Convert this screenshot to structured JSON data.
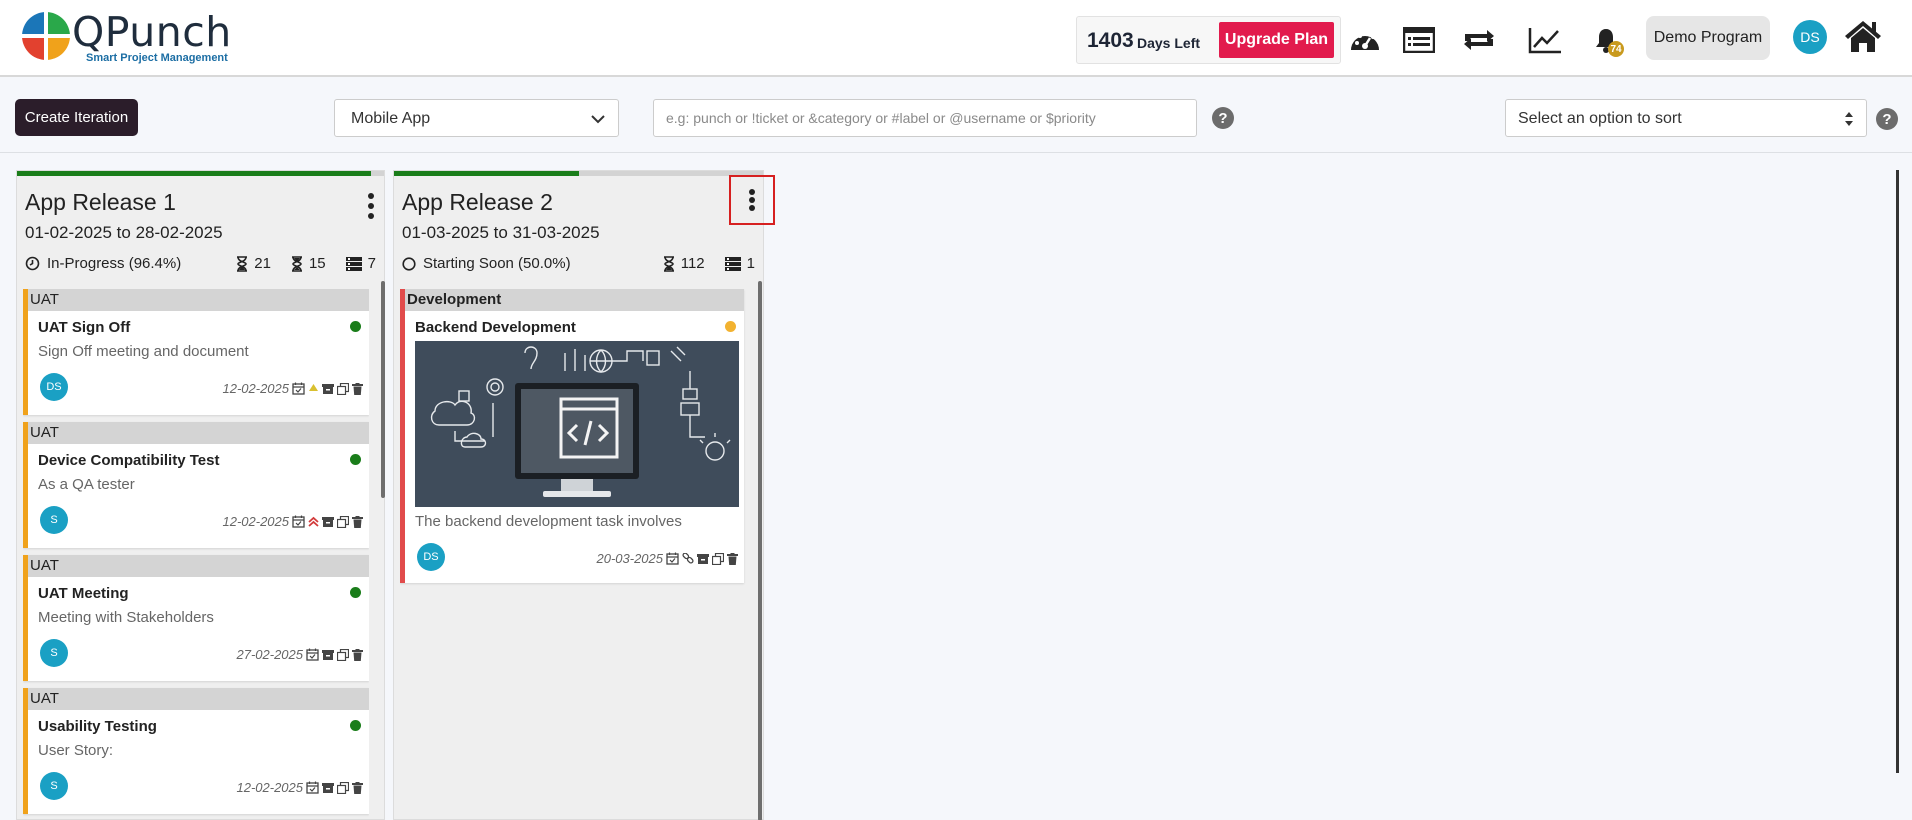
{
  "header": {
    "logo_text": "QPunch",
    "logo_tagline": "Smart Project Management",
    "days_left_number": "1403",
    "days_left_label": "Days Left",
    "upgrade_label": "Upgrade Plan",
    "notification_count": "74",
    "program_label": "Demo Program",
    "user_initials": "DS"
  },
  "toolbar": {
    "create_label": "Create Iteration",
    "project_selected": "Mobile App",
    "search_placeholder": "e.g: punch or !ticket or &category or #label or @username or $priority",
    "sort_placeholder": "Select an option to sort",
    "help_glyph": "?"
  },
  "iterations": [
    {
      "title": "App Release 1",
      "dates": "01-02-2025 to 28-02-2025",
      "status": "In-Progress (96.4%)",
      "progress": 0.964,
      "stat_a": "21",
      "stat_b": "15",
      "stat_c": "7",
      "cards": [
        {
          "category": "UAT",
          "title": "UAT Sign Off",
          "desc": "Sign Off meeting and document",
          "assignee": "DS",
          "date": "12-02-2025",
          "status_color": "#1a7d1a",
          "priority": "up-yellow"
        },
        {
          "category": "UAT",
          "title": "Device Compatibility Test",
          "desc": "As a QA tester",
          "assignee": "S",
          "date": "12-02-2025",
          "status_color": "#1a7d1a",
          "priority": "double-up-red"
        },
        {
          "category": "UAT",
          "title": "UAT Meeting",
          "desc": "Meeting with Stakeholders",
          "assignee": "S",
          "date": "27-02-2025",
          "status_color": "#1a7d1a",
          "priority": "none"
        },
        {
          "category": "UAT",
          "title": "Usability Testing",
          "desc": "User Story:",
          "assignee": "S",
          "date": "12-02-2025",
          "status_color": "#1a7d1a",
          "priority": "none"
        }
      ]
    },
    {
      "title": "App Release 2",
      "dates": "01-03-2025 to 31-03-2025",
      "status": "Starting Soon (50.0%)",
      "progress": 0.5,
      "stat_a": "112",
      "stat_c": "1",
      "cards": [
        {
          "category": "Development",
          "title": "Backend Development",
          "desc": "The backend development task involves",
          "assignee": "DS",
          "date": "20-03-2025",
          "status_color": "#f2b230",
          "priority": "link"
        }
      ]
    }
  ],
  "colors": {
    "upgrade": "#e21b4d",
    "create_button": "#2b1d2a",
    "progress": "#1a7d1a",
    "avatar": "#1aa0c4",
    "card_border_orange": "#f0a21b",
    "card_border_red": "#e14b4b"
  },
  "icons": [
    "dashboard-gauge-icon",
    "list-view-icon",
    "repeat-icon",
    "trend-chart-icon",
    "bell-icon",
    "home-icon"
  ]
}
